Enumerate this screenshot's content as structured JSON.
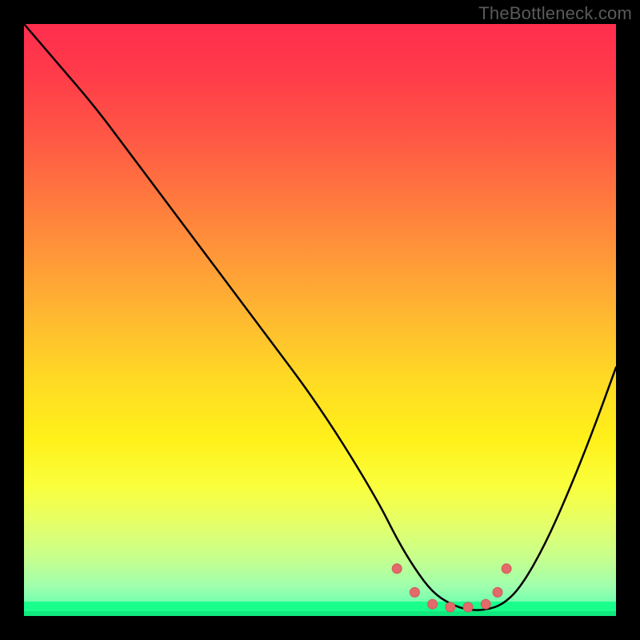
{
  "watermark": "TheBottleneck.com",
  "colors": {
    "curve_stroke": "#000000",
    "marker_fill": "#e26a6a",
    "marker_stroke": "#d25a5a"
  },
  "chart_data": {
    "type": "line",
    "title": "",
    "xlabel": "",
    "ylabel": "",
    "xlim": [
      0,
      100
    ],
    "ylim": [
      0,
      100
    ],
    "series": [
      {
        "name": "curve",
        "x": [
          0,
          6,
          12,
          18,
          24,
          30,
          36,
          42,
          48,
          54,
          60,
          63,
          66,
          69,
          72,
          75,
          78,
          81,
          84,
          88,
          92,
          96,
          100
        ],
        "y": [
          100,
          93,
          86,
          78,
          70,
          62,
          54,
          46,
          38,
          29,
          19,
          13,
          8,
          4,
          2,
          1,
          1,
          2,
          5,
          12,
          21,
          31,
          42
        ]
      }
    ],
    "markers": [
      {
        "x": 63,
        "y": 8
      },
      {
        "x": 66,
        "y": 4
      },
      {
        "x": 69,
        "y": 2
      },
      {
        "x": 72,
        "y": 1.5
      },
      {
        "x": 75,
        "y": 1.5
      },
      {
        "x": 78,
        "y": 2
      },
      {
        "x": 80,
        "y": 4
      },
      {
        "x": 81.5,
        "y": 8
      }
    ]
  }
}
